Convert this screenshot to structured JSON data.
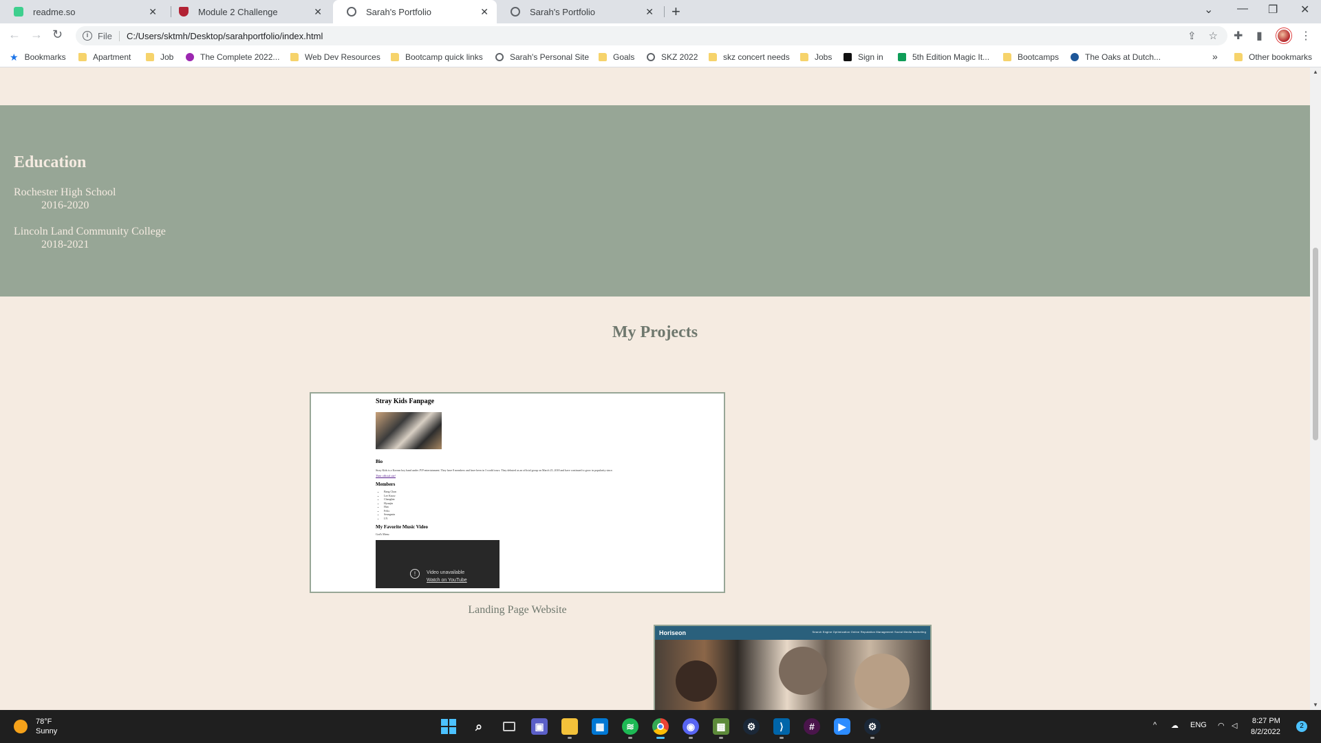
{
  "browser": {
    "tabs": [
      {
        "title": "readme.so",
        "favicon_color": "#3ecf8e",
        "active": false
      },
      {
        "title": "Module 2 Challenge",
        "favicon_color": "#b22234",
        "active": false
      },
      {
        "title": "Sarah's Portfolio",
        "favicon": "globe-icon",
        "active": true
      },
      {
        "title": "Sarah's Portfolio",
        "favicon": "globe-icon",
        "active": false
      }
    ],
    "address": {
      "scheme": "File",
      "url": "C:/Users/sktmh/Desktop/sarahportfolio/index.html"
    },
    "bookmarks": [
      {
        "label": "Bookmarks",
        "icon": "star-icon"
      },
      {
        "label": "Apartment",
        "icon": "folder-icon"
      },
      {
        "label": "Job",
        "icon": "folder-icon"
      },
      {
        "label": "The Complete 2022...",
        "icon": "purple-circle-icon"
      },
      {
        "label": "Web Dev Resources",
        "icon": "folder-icon"
      },
      {
        "label": "Bootcamp quick links",
        "icon": "folder-icon"
      },
      {
        "label": "Sarah's Personal Site",
        "icon": "globe-icon"
      },
      {
        "label": "Goals",
        "icon": "folder-icon"
      },
      {
        "label": "SKZ 2022",
        "icon": "globe-icon"
      },
      {
        "label": "skz concert needs",
        "icon": "folder-icon"
      },
      {
        "label": "Jobs",
        "icon": "folder-icon"
      },
      {
        "label": "Sign in",
        "icon": "uw-icon"
      },
      {
        "label": "5th Edition Magic It...",
        "icon": "sheets-icon"
      },
      {
        "label": "Bootcamps",
        "icon": "folder-icon"
      },
      {
        "label": "The Oaks at Dutch...",
        "icon": "oaks-icon"
      }
    ],
    "overflow": "»",
    "other_bookmarks": "Other bookmarks"
  },
  "page": {
    "education": {
      "heading": "Education",
      "schools": [
        {
          "name": "Rochester High School",
          "years": "2016-2020"
        },
        {
          "name": "Lincoln Land Community College",
          "years": "2018-2021"
        }
      ]
    },
    "projects_heading": "My Projects",
    "project1": {
      "label": "Landing Page Website",
      "preview": {
        "title": "Stray Kids Fanpage",
        "bio_heading": "Bio",
        "bio_text": "Stray Kids is a Korean boy band under JYP entertainment. They have 8 members and have been in 3 world tours. They debuted as an official group on March 25, 2018 and have continued to grow in popularity since.",
        "link": "Their official site!",
        "members_heading": "Members",
        "members": [
          "Bang Chan",
          "Lee Know",
          "Changbin",
          "Hyunjin",
          "Han",
          "Felix",
          "Seungmin",
          "I.N"
        ],
        "video_heading": "My Favorite Music Video",
        "video_sub": "God's Menu",
        "video_unavailable": "Video unavailable",
        "video_watch": "Watch on YouTube"
      }
    },
    "project2": {
      "preview": {
        "brand": "Horiseon",
        "nav": "Search Engine Optimization    Online Reputation Management    Social Media Marketing"
      }
    }
  },
  "taskbar": {
    "weather": {
      "temp": "78°F",
      "condition": "Sunny"
    },
    "tray": {
      "language": "ENG"
    },
    "clock": {
      "time": "8:27 PM",
      "date": "8/2/2022"
    },
    "notifications": "2",
    "accent": "#4cc2ff"
  }
}
